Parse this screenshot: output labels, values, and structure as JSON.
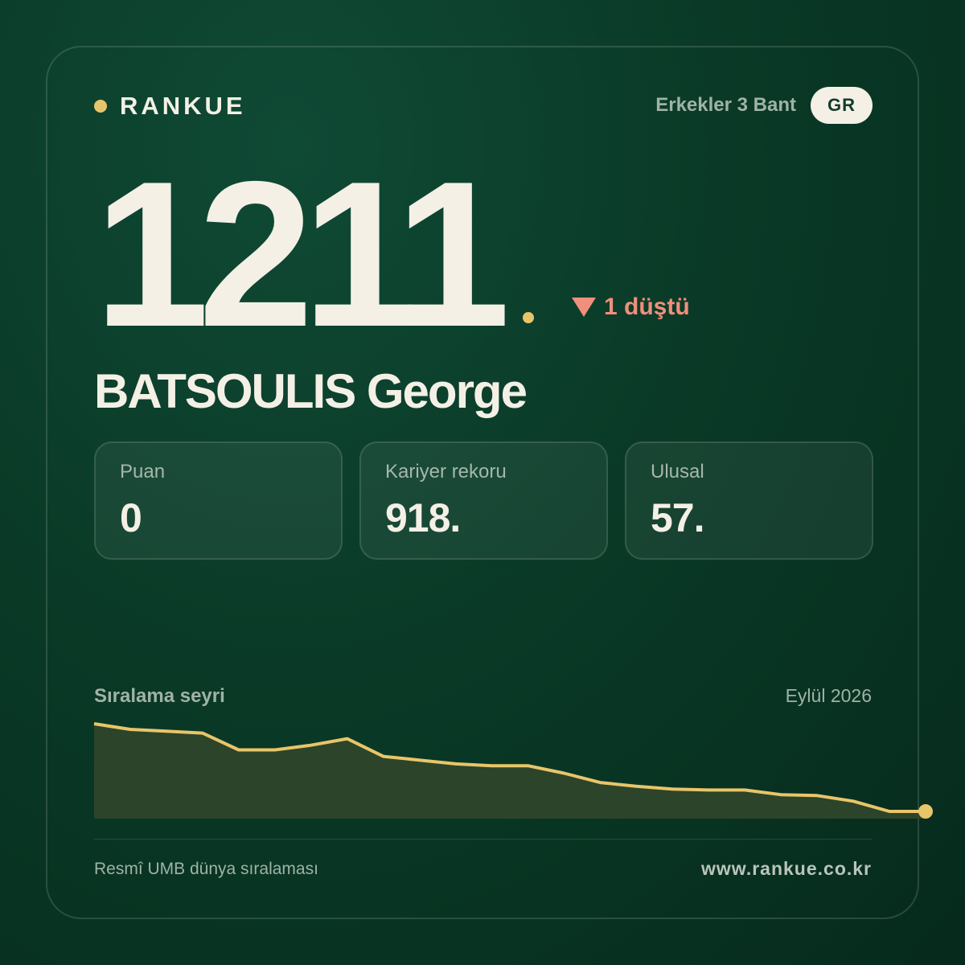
{
  "brand": {
    "name": "RANKUE",
    "accent_color": "#e8c56a"
  },
  "header": {
    "category": "Erkekler 3 Bant",
    "country": "GR"
  },
  "rank": {
    "value": "1211",
    "change_text": "1 düştü",
    "change_direction": "down",
    "change_color": "#f08f7c"
  },
  "player": {
    "name": "BATSOULIS George"
  },
  "stats": [
    {
      "label": "Puan",
      "value": "0"
    },
    {
      "label": "Kariyer rekoru",
      "value": "918."
    },
    {
      "label": "Ulusal",
      "value": "57."
    }
  ],
  "trend": {
    "title": "Sıralama seyri",
    "date": "Eylül 2026"
  },
  "chart_data": {
    "type": "area",
    "values": [
      100,
      94,
      92,
      90,
      72,
      72,
      77,
      84,
      65,
      61,
      57,
      55,
      55,
      47,
      37,
      33,
      30,
      29,
      29,
      24,
      23,
      17,
      6,
      6
    ],
    "ylim": [
      0,
      100
    ],
    "line_color": "#e8c56a",
    "fill_color": "#2c4429",
    "grid": false,
    "legend": "none"
  },
  "footer": {
    "source": "Resmî UMB dünya sıralaması",
    "website": "www.rankue.co.kr"
  }
}
